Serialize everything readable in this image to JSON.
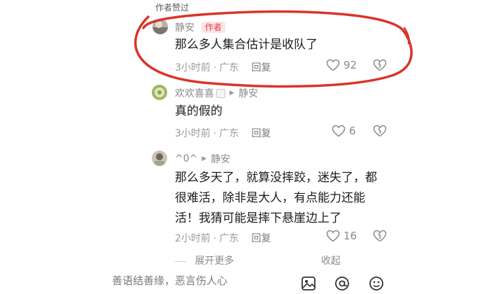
{
  "section_label": "作者赞过",
  "comments": [
    {
      "author": "静安",
      "badge": "作者",
      "text_lines": [
        "那么多人集合估计是收队了"
      ],
      "time": "3小时前",
      "location": "广东",
      "reply_label": "回复",
      "likes": "92"
    },
    {
      "author": "欢欢喜喜",
      "reply_to": "静安",
      "text_lines": [
        "真的假的"
      ],
      "time": "3小时前",
      "location": "广东",
      "reply_label": "回复",
      "likes": "6"
    },
    {
      "author": "^0^",
      "reply_to": "静安",
      "text_lines": [
        "那么多天了，就算没摔跤，迷失了，都",
        "很难活，除非是大人，有点能力还能",
        "活！我猜可能是摔下悬崖边上了"
      ],
      "time": "2小时前",
      "location": "广东",
      "reply_label": "回复",
      "likes": "16"
    }
  ],
  "expand_label": "展开更多",
  "collapse_label": "收起",
  "input_placeholder": "善语结善缘，恶言伤人心",
  "bottom_icons": [
    "image-icon",
    "at-icon",
    "emoji-icon"
  ],
  "colors": {
    "badge_bg": "#fde4e6",
    "badge_text": "#e8384f",
    "annotation_circle": "#d9352b"
  }
}
